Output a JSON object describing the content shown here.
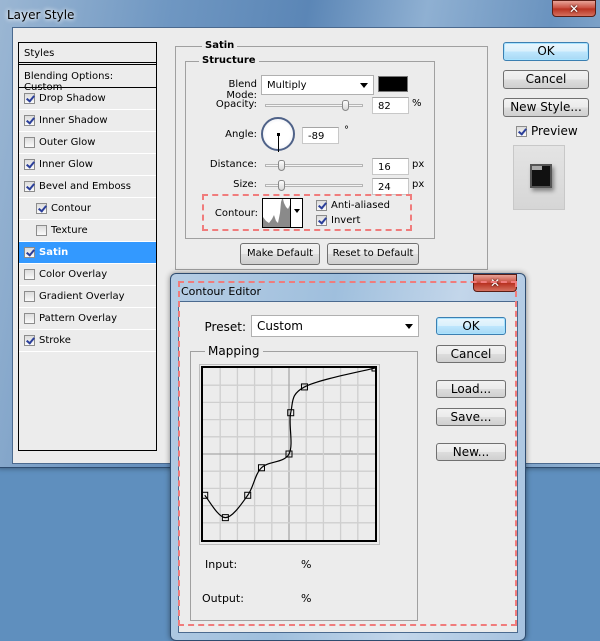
{
  "layer_style": {
    "title": "Layer Style",
    "close_glyph": "✕",
    "styles_header": "Styles",
    "blending_options": "Blending Options: Custom",
    "styles": [
      {
        "label": "Drop Shadow",
        "checked": true,
        "sub": false,
        "selected": false
      },
      {
        "label": "Inner Shadow",
        "checked": true,
        "sub": false,
        "selected": false
      },
      {
        "label": "Outer Glow",
        "checked": false,
        "sub": false,
        "selected": false
      },
      {
        "label": "Inner Glow",
        "checked": true,
        "sub": false,
        "selected": false
      },
      {
        "label": "Bevel and Emboss",
        "checked": true,
        "sub": false,
        "selected": false
      },
      {
        "label": "Contour",
        "checked": true,
        "sub": true,
        "selected": false
      },
      {
        "label": "Texture",
        "checked": false,
        "sub": true,
        "selected": false
      },
      {
        "label": "Satin",
        "checked": true,
        "sub": false,
        "selected": true
      },
      {
        "label": "Color Overlay",
        "checked": false,
        "sub": false,
        "selected": false
      },
      {
        "label": "Gradient Overlay",
        "checked": false,
        "sub": false,
        "selected": false
      },
      {
        "label": "Pattern Overlay",
        "checked": false,
        "sub": false,
        "selected": false
      },
      {
        "label": "Stroke",
        "checked": true,
        "sub": false,
        "selected": false
      }
    ],
    "satin": {
      "section_title": "Satin",
      "structure_title": "Structure",
      "blend_mode_label": "Blend Mode:",
      "blend_mode_value": "Multiply",
      "blend_color": "#000000",
      "opacity_label": "Opacity:",
      "opacity_value": "82",
      "opacity_unit": "%",
      "opacity_fraction": 0.82,
      "angle_label": "Angle:",
      "angle_value": "-89",
      "angle_unit": "°",
      "distance_label": "Distance:",
      "distance_value": "16",
      "distance_unit": "px",
      "distance_fraction": 0.16,
      "size_label": "Size:",
      "size_value": "24",
      "size_unit": "px",
      "size_fraction": 0.16,
      "contour_label": "Contour:",
      "anti_aliased_label": "Anti-aliased",
      "anti_aliased": true,
      "invert_label": "Invert",
      "invert": true,
      "make_default": "Make Default",
      "reset_default": "Reset to Default"
    },
    "buttons": {
      "ok": "OK",
      "cancel": "Cancel",
      "new_style": "New Style...",
      "preview_label": "Preview",
      "preview_checked": true
    }
  },
  "contour_editor": {
    "title": "Contour Editor",
    "close_glyph": "✕",
    "preset_label": "Preset:",
    "preset_value": "Custom",
    "mapping_label": "Mapping",
    "input_label": "Input:",
    "input_value": "",
    "input_unit": "%",
    "output_label": "Output:",
    "output_value": "",
    "output_unit": "%",
    "buttons": {
      "ok": "OK",
      "cancel": "Cancel",
      "load": "Load...",
      "save": "Save...",
      "new": "New..."
    },
    "curve_points": [
      {
        "input": 1,
        "output": 26
      },
      {
        "input": 13,
        "output": 13
      },
      {
        "input": 26,
        "output": 26
      },
      {
        "input": 34,
        "output": 42
      },
      {
        "input": 50,
        "output": 50
      },
      {
        "input": 51,
        "output": 74
      },
      {
        "input": 59,
        "output": 89
      },
      {
        "input": 100,
        "output": 100
      }
    ]
  },
  "annotation_color": "#f07c7c"
}
